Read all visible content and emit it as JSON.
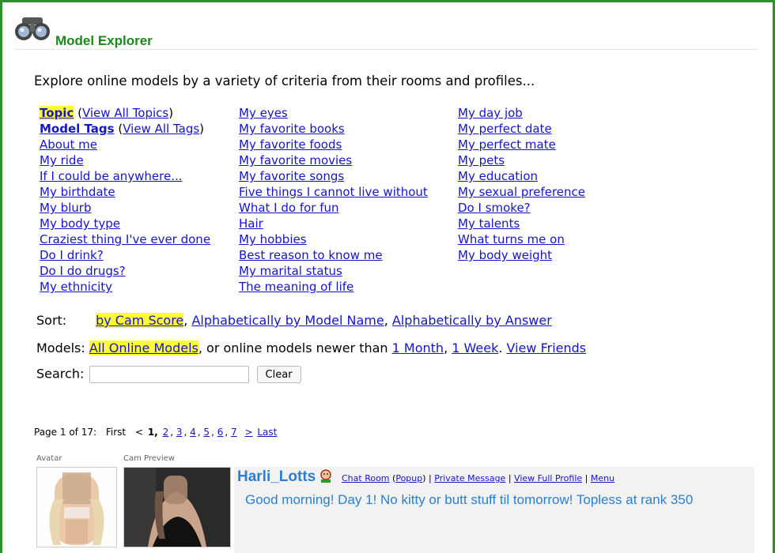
{
  "header": {
    "title": "Model Explorer",
    "logo_icon": "binoculars-icon"
  },
  "intro": "Explore online models by a variety of criteria from their rooms and profiles...",
  "topics": {
    "col1": [
      {
        "label": "Topic",
        "extra": "View All Topics",
        "hl": true
      },
      {
        "label": "Model Tags",
        "extra": "View All Tags",
        "hl": false
      },
      {
        "label": "About me"
      },
      {
        "label": "My ride"
      },
      {
        "label": "If I could be anywhere..."
      },
      {
        "label": "My birthdate"
      },
      {
        "label": "My blurb"
      },
      {
        "label": "My body type"
      },
      {
        "label": "Craziest thing I've ever done"
      },
      {
        "label": "Do I drink?"
      },
      {
        "label": "Do I do drugs?"
      },
      {
        "label": "My ethnicity"
      }
    ],
    "col2": [
      "My eyes",
      "My favorite books",
      "My favorite foods",
      "My favorite movies",
      "My favorite songs",
      "Five things I cannot live without",
      "What I do for fun",
      "Hair",
      "My hobbies",
      "Best reason to know me",
      "My marital status",
      "The meaning of life"
    ],
    "col3": [
      "My day job",
      "My perfect date",
      "My perfect mate",
      "My pets",
      "My education",
      "My sexual preference",
      "Do I smoke?",
      "My talents",
      "What turns me on",
      "My body weight"
    ]
  },
  "sort": {
    "label": "Sort:",
    "by_cam_score": "by Cam Score",
    "sep1": ", ",
    "alpha_model": "Alphabetically by Model Name",
    "sep2": ", ",
    "alpha_answer": "Alphabetically by Answer"
  },
  "models": {
    "label": "Models:",
    "all_online": "All Online Models",
    "text": ", or online models newer than ",
    "one_month": "1 Month",
    "sep": ", ",
    "one_week": "1 Week",
    "dot": ". ",
    "view_friends": "View Friends"
  },
  "search": {
    "label": "Search:",
    "value": "",
    "placeholder": "",
    "clear": "Clear"
  },
  "pager": {
    "text": "Page 1 of 17:",
    "first": "First",
    "lt": "<",
    "current": "1,",
    "pages": [
      "2",
      "3",
      "4",
      "5",
      "6",
      "7"
    ],
    "next": ">",
    "last": "Last"
  },
  "columns": {
    "avatar": "Avatar",
    "cam_preview": "Cam Preview"
  },
  "model": {
    "name": "Harli_Lotts",
    "status_icon": "webcam-status-icon",
    "chat_room": "Chat Room",
    "popup": "Popup",
    "private_message": "Private Message",
    "view_profile": "View Full Profile",
    "menu": "Menu",
    "message": "Good morning! Day 1! No kitty or butt stuff til tomorrow! Topless at rank 350"
  },
  "colors": {
    "frame": "#2f8f2f",
    "title": "#1a8a1a",
    "link": "#1515c9",
    "highlight": "#ffff33",
    "model": "#2a7fd4"
  }
}
